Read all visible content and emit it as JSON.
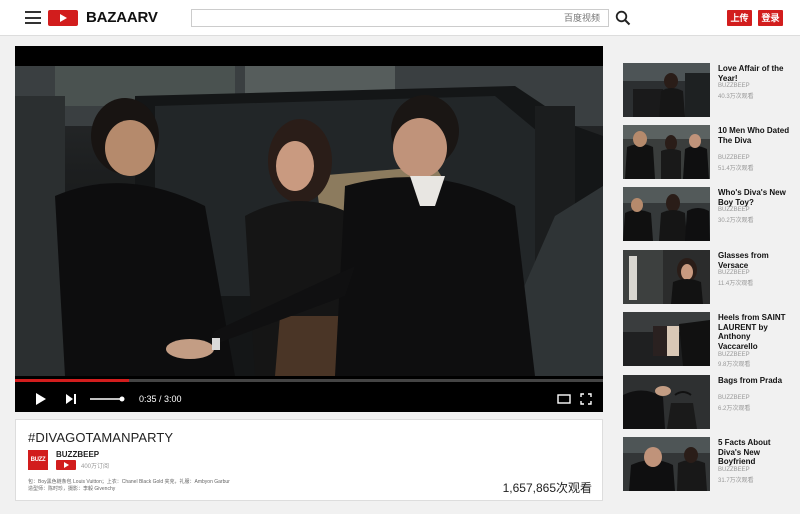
{
  "header": {
    "logo_text": "BAZAARV",
    "search_placeholder": "百度视频",
    "upload_label": "上传",
    "login_label": "登录"
  },
  "player": {
    "time": "0:35 / 3:00",
    "progress_fraction": 0.194
  },
  "video": {
    "title": "#DIVAGOTAMANPARTY",
    "channel_avatar": "BUZZ",
    "channel_name": "BUZZBEEP",
    "subscriber_text": "400万订阅",
    "credits": [
      "包：Boy黑色链条包 Louis Vuitton；上衣：Chanel Black Gold 夹克，礼服：Ambyon Garbur",
      "造型师：陈时珍，摄影：李毅 Givenchy"
    ],
    "views": "1,657,865次观看"
  },
  "sidebar": {
    "items": [
      {
        "title": "Love Affair of the Year!",
        "channel": "BUZZBEEP",
        "views": "40.3万次观看"
      },
      {
        "title": "10 Men Who Dated The Diva",
        "channel": "BUZZBEEP",
        "views": "51.4万次观看"
      },
      {
        "title": "Who's Diva's New Boy Toy?",
        "channel": "BUZZBEEP",
        "views": "30.2万次观看"
      },
      {
        "title": "Glasses from Versace",
        "channel": "BUZZBEEP",
        "views": "11.4万次观看"
      },
      {
        "title": "Heels from SAINT LAURENT by Anthony Vaccarello",
        "channel": "BUZZBEEP",
        "views": "9.8万次观看"
      },
      {
        "title": "Bags from Prada",
        "channel": "BUZZBEEP",
        "views": "6.2万次观看"
      },
      {
        "title": "5 Facts About Diva's New Boyfriend",
        "channel": "BUZZBEEP",
        "views": "31.7万次观看"
      }
    ]
  },
  "colors": {
    "accent": "#d21d1d",
    "page_bg": "#f1f1f1"
  }
}
